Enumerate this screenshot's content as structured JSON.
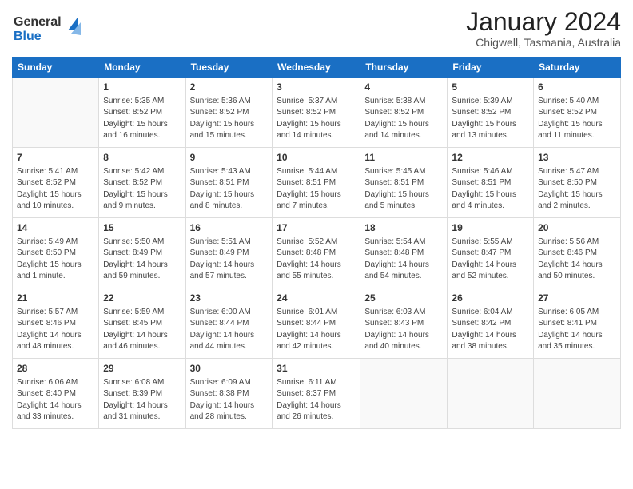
{
  "logo": {
    "line1": "General",
    "line2": "Blue"
  },
  "title": "January 2024",
  "subtitle": "Chigwell, Tasmania, Australia",
  "days_of_week": [
    "Sunday",
    "Monday",
    "Tuesday",
    "Wednesday",
    "Thursday",
    "Friday",
    "Saturday"
  ],
  "weeks": [
    [
      {
        "day": "",
        "info": ""
      },
      {
        "day": "1",
        "info": "Sunrise: 5:35 AM\nSunset: 8:52 PM\nDaylight: 15 hours\nand 16 minutes."
      },
      {
        "day": "2",
        "info": "Sunrise: 5:36 AM\nSunset: 8:52 PM\nDaylight: 15 hours\nand 15 minutes."
      },
      {
        "day": "3",
        "info": "Sunrise: 5:37 AM\nSunset: 8:52 PM\nDaylight: 15 hours\nand 14 minutes."
      },
      {
        "day": "4",
        "info": "Sunrise: 5:38 AM\nSunset: 8:52 PM\nDaylight: 15 hours\nand 14 minutes."
      },
      {
        "day": "5",
        "info": "Sunrise: 5:39 AM\nSunset: 8:52 PM\nDaylight: 15 hours\nand 13 minutes."
      },
      {
        "day": "6",
        "info": "Sunrise: 5:40 AM\nSunset: 8:52 PM\nDaylight: 15 hours\nand 11 minutes."
      }
    ],
    [
      {
        "day": "7",
        "info": "Sunrise: 5:41 AM\nSunset: 8:52 PM\nDaylight: 15 hours\nand 10 minutes."
      },
      {
        "day": "8",
        "info": "Sunrise: 5:42 AM\nSunset: 8:52 PM\nDaylight: 15 hours\nand 9 minutes."
      },
      {
        "day": "9",
        "info": "Sunrise: 5:43 AM\nSunset: 8:51 PM\nDaylight: 15 hours\nand 8 minutes."
      },
      {
        "day": "10",
        "info": "Sunrise: 5:44 AM\nSunset: 8:51 PM\nDaylight: 15 hours\nand 7 minutes."
      },
      {
        "day": "11",
        "info": "Sunrise: 5:45 AM\nSunset: 8:51 PM\nDaylight: 15 hours\nand 5 minutes."
      },
      {
        "day": "12",
        "info": "Sunrise: 5:46 AM\nSunset: 8:51 PM\nDaylight: 15 hours\nand 4 minutes."
      },
      {
        "day": "13",
        "info": "Sunrise: 5:47 AM\nSunset: 8:50 PM\nDaylight: 15 hours\nand 2 minutes."
      }
    ],
    [
      {
        "day": "14",
        "info": "Sunrise: 5:49 AM\nSunset: 8:50 PM\nDaylight: 15 hours\nand 1 minute."
      },
      {
        "day": "15",
        "info": "Sunrise: 5:50 AM\nSunset: 8:49 PM\nDaylight: 14 hours\nand 59 minutes."
      },
      {
        "day": "16",
        "info": "Sunrise: 5:51 AM\nSunset: 8:49 PM\nDaylight: 14 hours\nand 57 minutes."
      },
      {
        "day": "17",
        "info": "Sunrise: 5:52 AM\nSunset: 8:48 PM\nDaylight: 14 hours\nand 55 minutes."
      },
      {
        "day": "18",
        "info": "Sunrise: 5:54 AM\nSunset: 8:48 PM\nDaylight: 14 hours\nand 54 minutes."
      },
      {
        "day": "19",
        "info": "Sunrise: 5:55 AM\nSunset: 8:47 PM\nDaylight: 14 hours\nand 52 minutes."
      },
      {
        "day": "20",
        "info": "Sunrise: 5:56 AM\nSunset: 8:46 PM\nDaylight: 14 hours\nand 50 minutes."
      }
    ],
    [
      {
        "day": "21",
        "info": "Sunrise: 5:57 AM\nSunset: 8:46 PM\nDaylight: 14 hours\nand 48 minutes."
      },
      {
        "day": "22",
        "info": "Sunrise: 5:59 AM\nSunset: 8:45 PM\nDaylight: 14 hours\nand 46 minutes."
      },
      {
        "day": "23",
        "info": "Sunrise: 6:00 AM\nSunset: 8:44 PM\nDaylight: 14 hours\nand 44 minutes."
      },
      {
        "day": "24",
        "info": "Sunrise: 6:01 AM\nSunset: 8:44 PM\nDaylight: 14 hours\nand 42 minutes."
      },
      {
        "day": "25",
        "info": "Sunrise: 6:03 AM\nSunset: 8:43 PM\nDaylight: 14 hours\nand 40 minutes."
      },
      {
        "day": "26",
        "info": "Sunrise: 6:04 AM\nSunset: 8:42 PM\nDaylight: 14 hours\nand 38 minutes."
      },
      {
        "day": "27",
        "info": "Sunrise: 6:05 AM\nSunset: 8:41 PM\nDaylight: 14 hours\nand 35 minutes."
      }
    ],
    [
      {
        "day": "28",
        "info": "Sunrise: 6:06 AM\nSunset: 8:40 PM\nDaylight: 14 hours\nand 33 minutes."
      },
      {
        "day": "29",
        "info": "Sunrise: 6:08 AM\nSunset: 8:39 PM\nDaylight: 14 hours\nand 31 minutes."
      },
      {
        "day": "30",
        "info": "Sunrise: 6:09 AM\nSunset: 8:38 PM\nDaylight: 14 hours\nand 28 minutes."
      },
      {
        "day": "31",
        "info": "Sunrise: 6:11 AM\nSunset: 8:37 PM\nDaylight: 14 hours\nand 26 minutes."
      },
      {
        "day": "",
        "info": ""
      },
      {
        "day": "",
        "info": ""
      },
      {
        "day": "",
        "info": ""
      }
    ]
  ]
}
